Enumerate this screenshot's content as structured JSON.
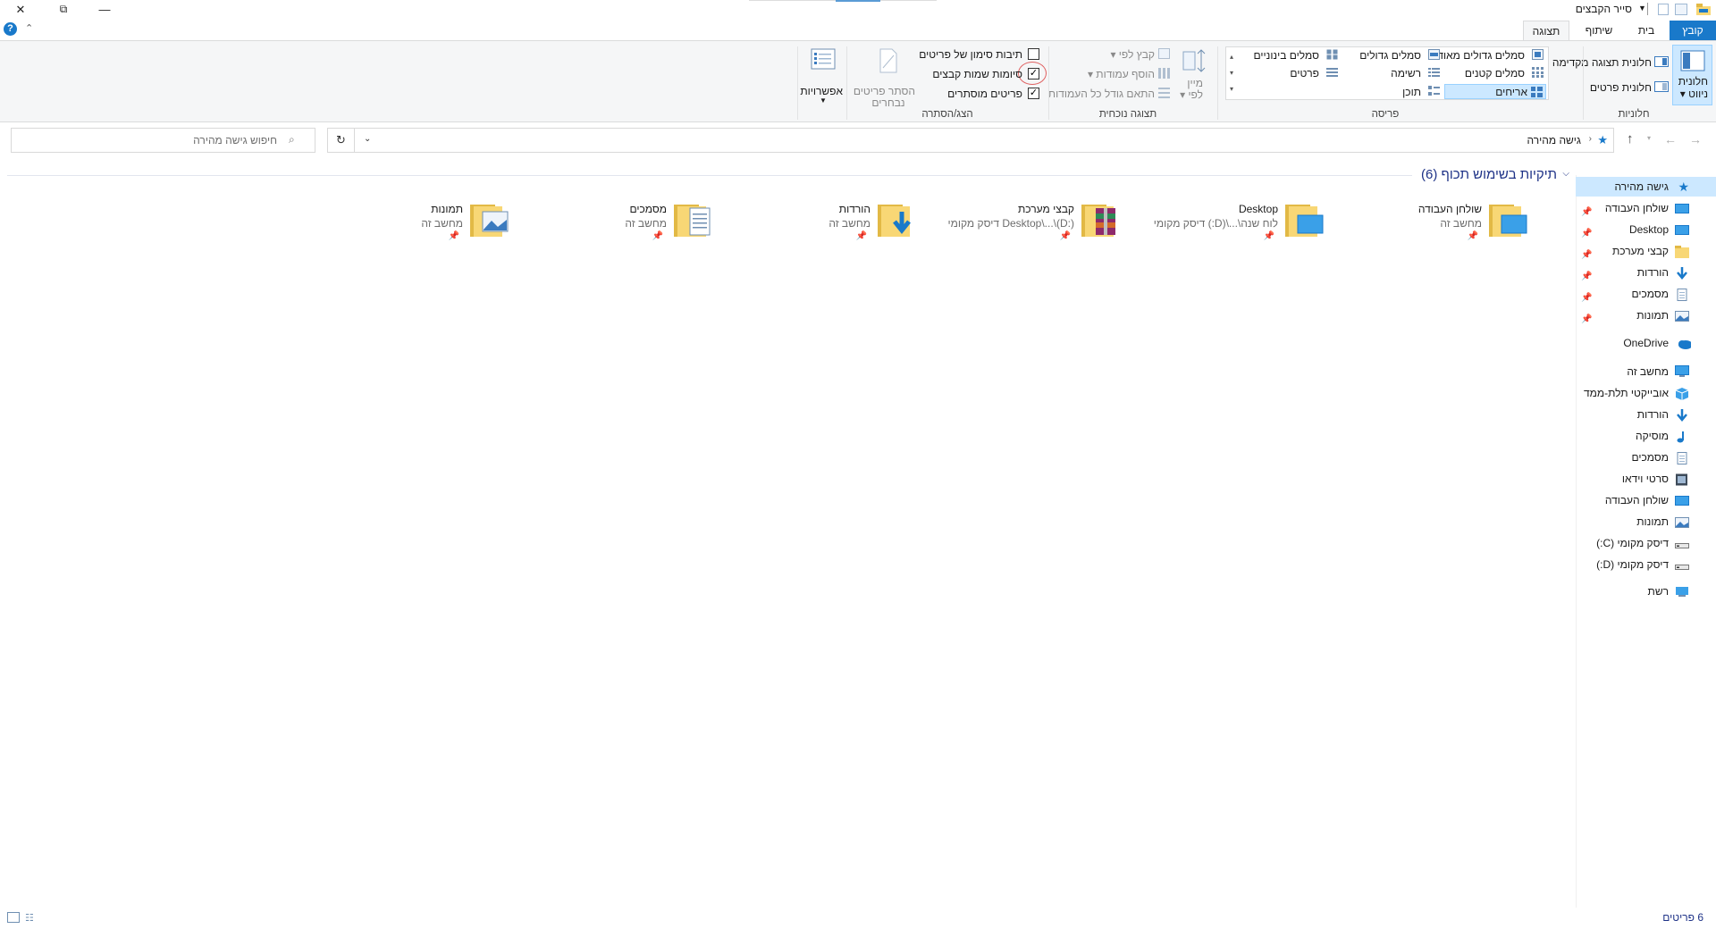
{
  "window": {
    "title": "סייר הקבצים",
    "controls": {
      "close": "✕",
      "restore": "⧉",
      "minimize": "—"
    }
  },
  "tabs": {
    "file": "קובץ",
    "home": "בית",
    "share": "שיתוף",
    "view": "תצוגה",
    "collapse_glyph": "⌃",
    "help_glyph": "?"
  },
  "ribbon": {
    "panes": {
      "group_label": "חלוניות",
      "navigation_pane": "חלונית",
      "navigation_pane_2": "ניווט",
      "preview_pane": "חלונית תצוגה מקדימה",
      "details_pane": "חלונית פרטים"
    },
    "layout": {
      "group_label": "פריסה",
      "extra_large_icons": "סמלים גדולים מאוד",
      "large_icons": "סמלים גדולים",
      "medium_icons": "סמלים בינוניים",
      "small_icons": "סמלים קטנים",
      "list": "רשימה",
      "details": "פרטים",
      "tiles": "אריחים",
      "content": "תוכן"
    },
    "current_view": {
      "group_label": "תצוגה נוכחית",
      "sort_by": "מיין",
      "sort_by_2": "לפי",
      "group_by": "קבץ לפי",
      "add_columns": "הוסף עמודות",
      "size_all_columns": "התאם גודל כל העמודות"
    },
    "show_hide": {
      "group_label": "הצג/הסתרה",
      "item_checkboxes": "תיבות סימון של פריטים",
      "item_checkboxes_checked": false,
      "file_name_extensions": "סיומות שמות קבצים",
      "file_name_extensions_checked": true,
      "hidden_items": "פריטים מוסתרים",
      "hidden_items_checked": true,
      "hide_selected": "הסתר פריטים",
      "hide_selected_2": "נבחרים"
    },
    "options": {
      "label": "אפשרויות"
    }
  },
  "address": {
    "path_root": "גישה מהירה",
    "search_placeholder": "חיפוש גישה מהירה"
  },
  "nav": {
    "quick_access": "גישה מהירה",
    "pinned": [
      "שולחן העבודה",
      "Desktop",
      "קבצי מערכת",
      "הורדות",
      "מסמכים",
      "תמונות"
    ],
    "onedrive": "OneDrive",
    "this_pc": "מחשב זה",
    "pc_items": [
      "אובייקטי תלת-ממד",
      "הורדות",
      "מוסיקה",
      "מסמכים",
      "סרטי וידאו",
      "שולחן העבודה",
      "תמונות",
      "דיסק מקומי (C:)",
      "דיסק מקומי (D:)"
    ],
    "network": "רשת"
  },
  "content": {
    "group_header": "תיקיות בשימוש תכוף (6)",
    "tiles": [
      {
        "name": "שולחן העבודה",
        "sub": "מחשב זה"
      },
      {
        "name": "Desktop",
        "sub": "לוח שנה\\...\\(D:) דיסק מקומי"
      },
      {
        "name": "קבצי מערכת",
        "sub": "Desktop\\...\\(D:) דיסק מקומי"
      },
      {
        "name": "הורדות",
        "sub": "מחשב זה"
      },
      {
        "name": "מסמכים",
        "sub": "מחשב זה"
      },
      {
        "name": "תמונות",
        "sub": "מחשב זה"
      }
    ]
  },
  "status": {
    "count": "6 פריטים"
  },
  "colors": {
    "accent": "#1979ca",
    "folder": "#f8d775",
    "selection": "#cce8ff",
    "highlight_circle": "#e06060"
  }
}
